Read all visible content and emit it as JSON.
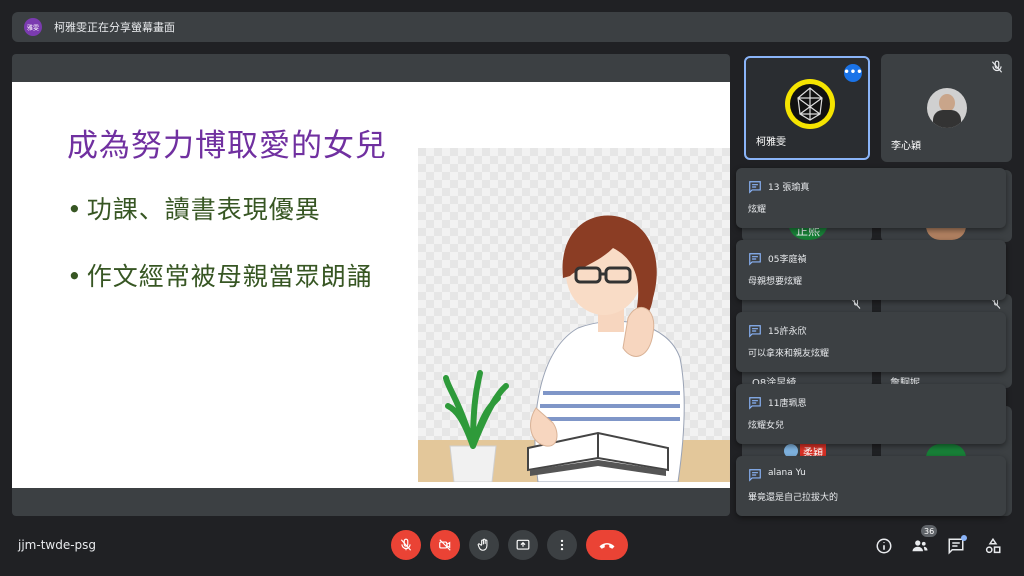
{
  "banner": {
    "avatar_text": "雅雯",
    "text": "柯雅雯正在分享螢幕畫面"
  },
  "slide": {
    "title": "成為努力博取愛的女兒",
    "bullets": [
      "功課、讀書表現優異",
      "作文經常被母親當眾朗誦"
    ],
    "bullet_glyph": "•"
  },
  "participants": [
    {
      "name": "柯雅雯",
      "avatar": "globe-avatar",
      "more_label": "•••"
    },
    {
      "name": "李心穎",
      "avatar": "photo-avatar"
    }
  ],
  "partial_tiles": [
    "正熙",
    "O8涂昱綺",
    "詹駉妮",
    "柔穎"
  ],
  "chat_toasts": [
    {
      "sender": "13 張瑜真",
      "message": "炫耀"
    },
    {
      "sender": "05李庭禎",
      "message": "母親想要炫耀"
    },
    {
      "sender": "15許永欣",
      "message": "可以拿來和親友炫耀"
    },
    {
      "sender": "11唐珮恩",
      "message": "炫耀女兒"
    },
    {
      "sender": "alana Yu",
      "message": "畢竟還是自己拉拔大的"
    }
  ],
  "bottom_bar": {
    "meeting_code": "jjm-twde-psg",
    "controls": [
      "mic-off-icon",
      "camera-off-icon",
      "raise-hand-icon",
      "present-icon",
      "more-options-icon",
      "hang-up-icon"
    ],
    "people_count": "36"
  },
  "colors": {
    "background": "#202124",
    "tile": "#3c4043",
    "accent": "#1a73e8",
    "danger": "#ea4335",
    "title_purple": "#7030a0",
    "bullet_green": "#375623"
  }
}
